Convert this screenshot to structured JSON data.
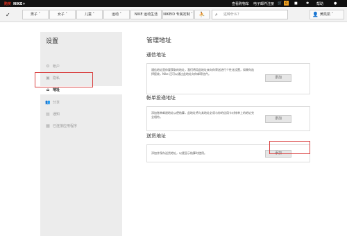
{
  "topbar": {
    "brand_red": "购买",
    "brand_white": "NIKE+",
    "link_cart": "查看购物车",
    "link_register": "电子邮件注册",
    "cart_count": "0",
    "help": "帮助"
  },
  "navbar": {
    "items": [
      {
        "label": "男子 ˅"
      },
      {
        "label": "女子 ˅"
      },
      {
        "label": "儿童 ˅"
      },
      {
        "label": "运动 ˅"
      },
      {
        "label": "NIKE 运动生活"
      },
      {
        "label": "NIKEiD 专属定制 ˅"
      }
    ],
    "search_placeholder": "这种什么？",
    "user_label": "黄凯凯 ˅"
  },
  "sidebar": {
    "title": "设置",
    "items": [
      {
        "label": "帐户",
        "icon": "gear-icon"
      },
      {
        "label": "隐私",
        "icon": "lock-icon"
      },
      {
        "label": "地址",
        "icon": "home-icon"
      },
      {
        "label": "分享",
        "icon": "share-icon"
      },
      {
        "label": "通知",
        "icon": "notification-icon"
      },
      {
        "label": "已连接应用程序",
        "icon": "apps-icon"
      }
    ]
  },
  "main": {
    "title": "管理地址",
    "sections": [
      {
        "heading": "通信地址",
        "description": "通信地址是你要获取的地址，我们将用此地址来向你寄送进行个性化设置，如果你选择接收，Nike 还可以通过此地址向你邮寄信件。",
        "button": "添加"
      },
      {
        "heading": "帐单投递地址",
        "description": "添加账单邮递地址以便结算，此地址将与其地址必须与你的信用卡对帐单上的地址完全相符。",
        "button": "添加"
      },
      {
        "heading": "送货地址",
        "description": "添加并保存送货地址，以便显示结算时使用。",
        "button": "添加"
      }
    ]
  }
}
